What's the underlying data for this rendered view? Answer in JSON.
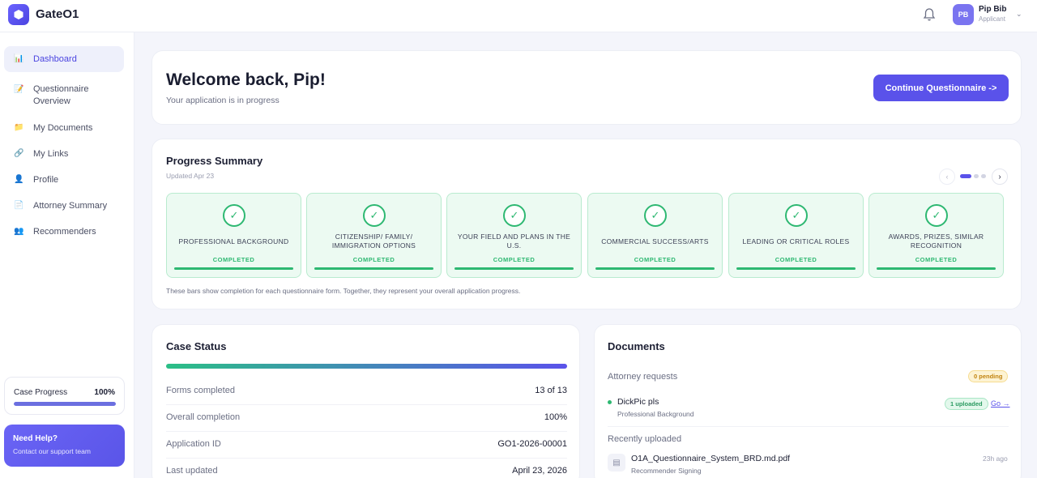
{
  "app": {
    "brand": "GateO1"
  },
  "user": {
    "initials": "PB",
    "name": "Pip Bib",
    "role": "Applicant"
  },
  "sidebar": {
    "items": [
      {
        "label": "Dashboard",
        "icon": "dashboard-icon",
        "glyph": "📊",
        "active": true
      },
      {
        "label": "Questionnaire Overview",
        "icon": "questionnaire-icon",
        "glyph": "📝",
        "active": false
      },
      {
        "label": "My Documents",
        "icon": "folder-icon",
        "glyph": "📁",
        "active": false
      },
      {
        "label": "My Links",
        "icon": "link-icon",
        "glyph": "🔗",
        "active": false
      },
      {
        "label": "Profile",
        "icon": "profile-icon",
        "glyph": "👤",
        "active": false
      },
      {
        "label": "Attorney Summary",
        "icon": "summary-icon",
        "glyph": "📄",
        "active": false
      },
      {
        "label": "Recommenders",
        "icon": "people-icon",
        "glyph": "👥",
        "active": false
      }
    ],
    "case_progress": {
      "label": "Case Progress",
      "value": "100%",
      "fraction": 1.0
    },
    "help": {
      "title": "Need Help?",
      "subtitle": "Contact our support team"
    }
  },
  "welcome": {
    "title": "Welcome back, Pip!",
    "subtitle": "Your application is in progress",
    "button": "Continue Questionnaire ->"
  },
  "progress_summary": {
    "title": "Progress Summary",
    "updated": "Updated Apr 23",
    "note": "These bars show completion for each questionnaire form. Together, they represent your overall application progress.",
    "steps": [
      {
        "label": "PROFESSIONAL BACKGROUND",
        "status": "COMPLETED",
        "fraction": 1.0
      },
      {
        "label": "CITIZENSHIP/ FAMILY/ IMMIGRATION OPTIONS",
        "status": "COMPLETED",
        "fraction": 1.0
      },
      {
        "label": "YOUR FIELD AND PLANS IN THE U.S.",
        "status": "COMPLETED",
        "fraction": 1.0
      },
      {
        "label": "COMMERCIAL SUCCESS/ARTS",
        "status": "COMPLETED",
        "fraction": 1.0
      },
      {
        "label": "LEADING OR CRITICAL ROLES",
        "status": "COMPLETED",
        "fraction": 1.0
      },
      {
        "label": "AWARDS, PRIZES, SIMILAR RECOGNITION",
        "status": "COMPLETED",
        "fraction": 1.0
      }
    ]
  },
  "case_status": {
    "title": "Case Status",
    "fraction": 1.0,
    "rows": [
      {
        "key": "Forms completed",
        "value": "13 of 13"
      },
      {
        "key": "Overall completion",
        "value": "100%"
      },
      {
        "key": "Application ID",
        "value": "GO1-2026-00001"
      },
      {
        "key": "Last updated",
        "value": "April 23, 2026"
      }
    ]
  },
  "documents": {
    "title": "Documents",
    "attorney_requests_label": "Attorney requests",
    "pending_badge": "0 pending",
    "request": {
      "title": "DickPic pls",
      "subtitle": "Professional Background",
      "badge": "1 uploaded",
      "link": "Go →"
    },
    "recently_uploaded_label": "Recently uploaded",
    "file": {
      "name": "O1A_Questionnaire_System_BRD.md.pdf",
      "subtitle": "Recommender Signing",
      "time": "23h ago"
    }
  }
}
